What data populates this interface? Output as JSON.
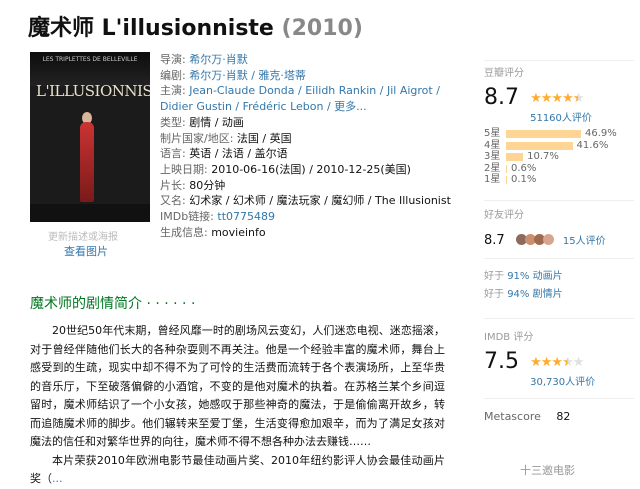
{
  "title": {
    "name": "魔术师 L'illusionniste",
    "year": "(2010)"
  },
  "poster": {
    "top_text": "LES TRIPLETTES DE BELLEVILLE",
    "logo": "L'ILLUSIONNISTE",
    "caption1": "更新描述或海报",
    "caption2": "查看图片"
  },
  "info": {
    "director": {
      "key": "导演:",
      "value": "希尔万·肖默"
    },
    "writer": {
      "key": "编剧:",
      "value": "希尔万·肖默 / 雅克·塔蒂"
    },
    "cast": {
      "key": "主演:",
      "value": "Jean-Claude Donda / Eilidh Rankin / Jil Aigrot / Didier Gustin / Frédéric Lebon / 更多..."
    },
    "genre": {
      "key": "类型:",
      "value": "剧情 / 动画"
    },
    "country": {
      "key": "制片国家/地区:",
      "value": "法国 / 英国"
    },
    "language": {
      "key": "语言:",
      "value": "英语 / 法语 / 盖尔语"
    },
    "release": {
      "key": "上映日期:",
      "value": "2010-06-16(法国) / 2010-12-25(美国)"
    },
    "runtime": {
      "key": "片长:",
      "value": "80分钟"
    },
    "aka": {
      "key": "又名:",
      "value": "幻术家 / 幻术师 / 魔法玩家 / 魔幻师 / The Illusionist"
    },
    "imdb": {
      "key": "IMDb链接:",
      "value": "tt0775489"
    },
    "source": {
      "key": "生成信息:",
      "value": "movieinfo"
    }
  },
  "rating": {
    "header": "豆瓣评分",
    "score": "8.7",
    "stars": 4.5,
    "count": "51160人评价"
  },
  "rating_bars": [
    {
      "label": "5星",
      "pct": "46.9%",
      "value": 46.9
    },
    {
      "label": "4星",
      "pct": "41.6%",
      "value": 41.6
    },
    {
      "label": "3星",
      "pct": "10.7%",
      "value": 10.7
    },
    {
      "label": "2星",
      "pct": "0.6%",
      "value": 0.6
    },
    {
      "label": "1星",
      "pct": "0.1%",
      "value": 0.1
    }
  ],
  "friends": {
    "header": "好友评分",
    "score": "8.7",
    "count": "15人评价",
    "avatar_colors": [
      "#8c6b5a",
      "#c98f6e",
      "#a06a52",
      "#d9a48c"
    ]
  },
  "better": {
    "line1_prefix": "好于 ",
    "line1_value": "91% 动画片",
    "line2_prefix": "好于 ",
    "line2_value": "94% 剧情片"
  },
  "imdb": {
    "header": "IMDB 评分",
    "score": "7.5",
    "stars": 3.5,
    "count": "30,730人评价"
  },
  "metascore": {
    "label": "Metascore",
    "value": "82"
  },
  "summary": {
    "title": "魔术师的剧情简介",
    "dots": " · · · · · ·",
    "p1": "20世纪50年代末期，曾经风靡一时的剧场风云变幻，人们迷恋电视、迷恋摇滚，对于曾经伴随他们长大的各种杂耍则不再关注。他是一个经验丰富的魔术师，舞台上感受到的生疏，现实中却不得不为了可怜的生活费而流转于各个表演场所，上至华贵的音乐厅，下至破落偏僻的小酒馆，不变的是他对魔术的执着。在苏格兰某个乡间逗留时，魔术师结识了一个小女孩，她感叹于那些神奇的魔法，于是偷偷离开故乡，转而追随魔术师的脚步。他们辗转来至爱丁堡，生活变得愈加艰辛，而为了满足女孩对魔法的信任和对繁华世界的向往，魔术师不得不想各种办法去赚钱……",
    "p2": "本片荣获2010年欧洲电影节最佳动画片奖、2010年纽约影评人协会最佳动画片奖（",
    "more": "..."
  },
  "watermark": "十三邀电影"
}
